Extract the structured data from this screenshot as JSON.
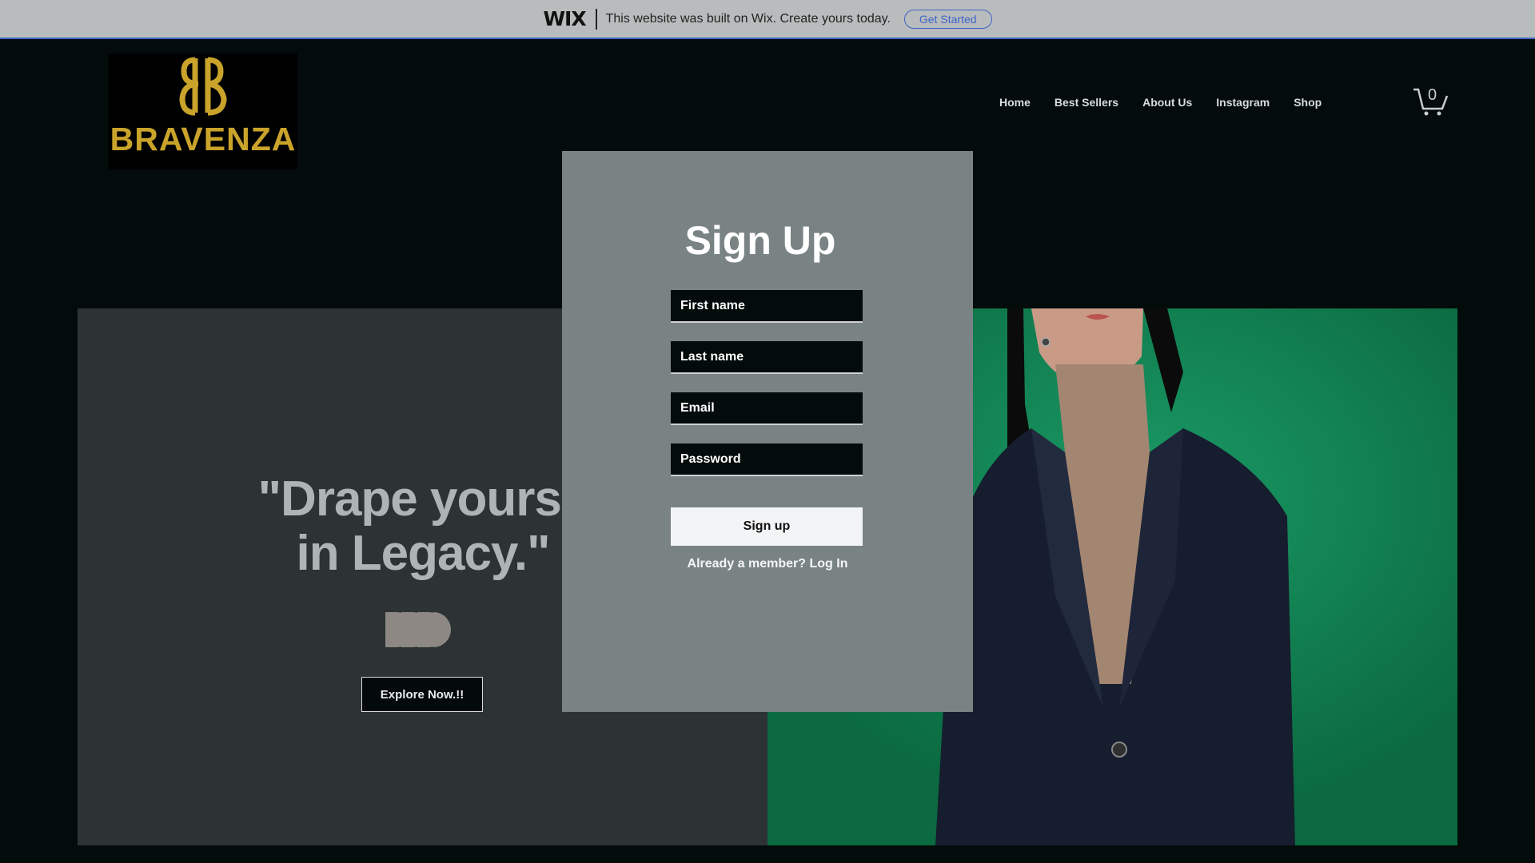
{
  "wix_banner": {
    "logo": "WIX",
    "message": "This website was built on Wix. Create yours today.",
    "cta": "Get Started"
  },
  "header": {
    "brand": "BRAVENZA",
    "nav": [
      "Home",
      "Best Sellers",
      "About Us",
      "Instagram",
      "Shop"
    ],
    "cart_count": "0"
  },
  "hero": {
    "quote_line1": "\"Drape yourse",
    "quote_line2": "in Legacy.\"",
    "explore_label": "Explore Now.!!"
  },
  "signup": {
    "title": "Sign Up",
    "fields": [
      "First name",
      "Last name",
      "Email",
      "Password"
    ],
    "submit_label": "Sign up",
    "login_prompt": "Already a member?",
    "login_link": "Log In"
  },
  "colors": {
    "background": "#030b0b",
    "brand_gold": "#c9a32a",
    "modal": "#7a8384",
    "hero_green": "#13875a",
    "wix_blue": "#3d64c8"
  },
  "icons": [
    "bb-monogram-icon",
    "cart-icon",
    "arrows-icon"
  ]
}
